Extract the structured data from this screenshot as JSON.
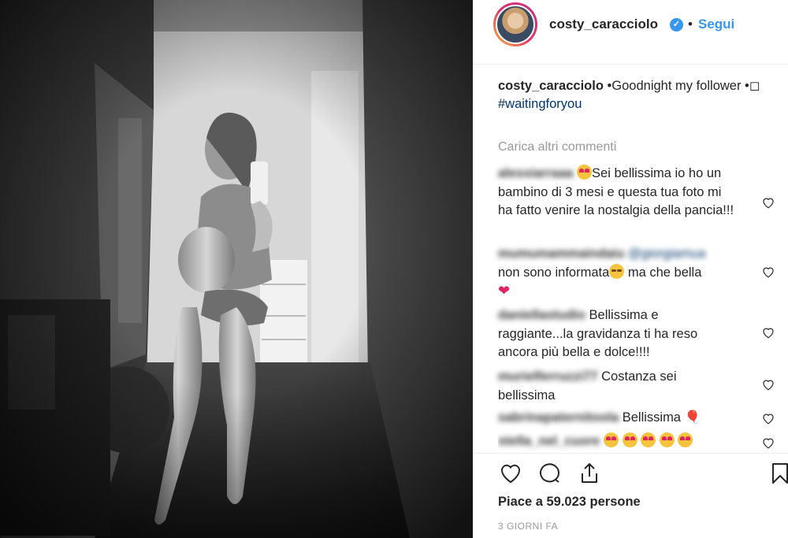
{
  "photo": {
    "alt_icon": "pregnancy-mirror-selfie-photo",
    "tone": "black-and-white"
  },
  "header": {
    "username": "costy_caracciolo",
    "verified_icon": "verified-badge-icon",
    "separator": "•",
    "follow_label": "Segui"
  },
  "caption": {
    "username": "costy_caracciolo",
    "text": "•Goodnight my follower •◻",
    "hashtag": "#waitingforyou"
  },
  "load_more_label": "Carica altri commenti",
  "comments": [
    {
      "user": "alessiarraaa",
      "text": "Sei bellissima io ho un bambino di 3 mesi e questa tua foto mi ha fatto venire la nostalgia della pancia!!!"
    },
    {
      "user": "mumumammaindaiu",
      "mention": "@giorgiamua",
      "text": "non sono informata",
      "text2": " ma che bella"
    },
    {
      "user": "daniellastudio",
      "text": "Bellissima e raggiante...la gravidanza ti ha reso ancora più bella e dolce!!!!"
    },
    {
      "user": "murielferruzzi77",
      "text": "Costanza sei bellissima"
    },
    {
      "user": "sabrinapaternitoola",
      "text": "Bellissima 🎈"
    },
    {
      "user": "stella_nel_cuore",
      "text": ""
    }
  ],
  "actions": {
    "like_icon": "heart-icon",
    "comment_icon": "comment-icon",
    "share_icon": "share-icon",
    "save_icon": "bookmark-icon"
  },
  "likes_label": "Piace a 59.023 persone",
  "time_ago": "3 GIORNI FA",
  "colors": {
    "link": "#3897f0",
    "hashtag": "#003569",
    "muted": "#999999",
    "text": "#262626"
  }
}
